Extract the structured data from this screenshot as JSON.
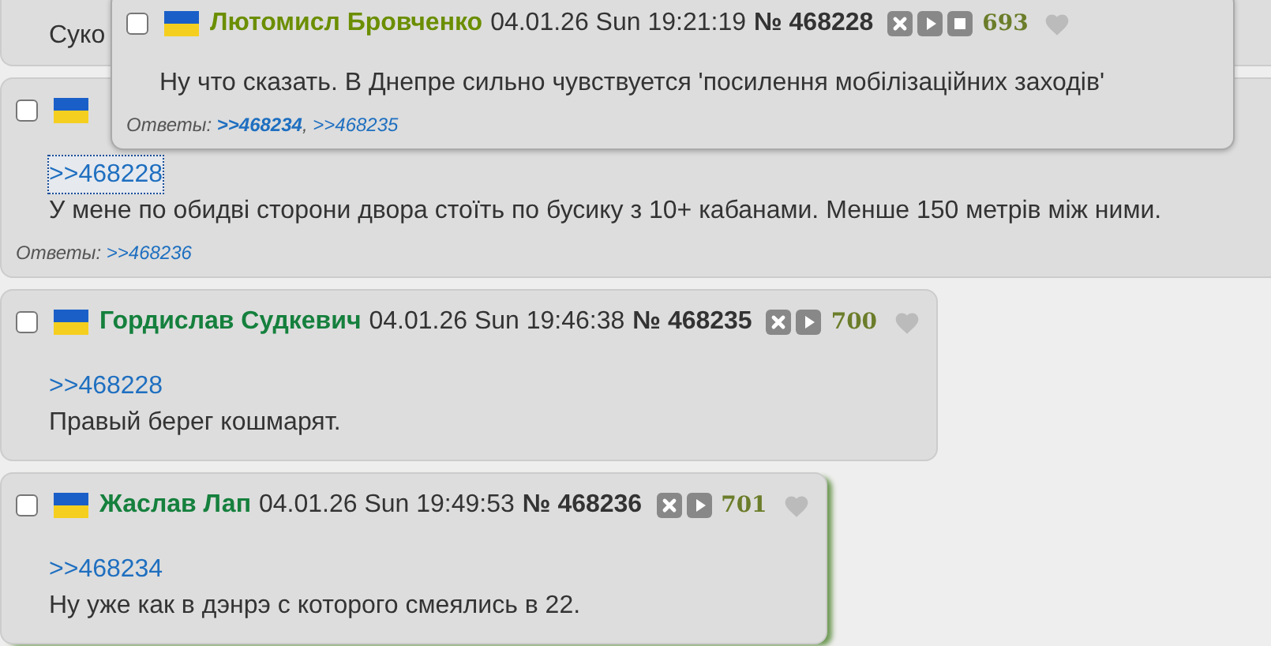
{
  "posts": [
    {
      "kind": "partial",
      "message": "Суко"
    },
    {
      "kind": "covered",
      "checked": false,
      "highlighted": false,
      "quote": {
        "text": ">>468228",
        "focused": true
      },
      "message": "У мене по обидві сторони двора стоїть по бусику з 10+ кабанами. Менше 150 метрів між ними.",
      "replies_label": "Ответы:",
      "replies": [
        {
          "text": ">>468236",
          "bold": false
        }
      ]
    },
    {
      "kind": "full",
      "checked": false,
      "highlighted": false,
      "author": "Гордислав Судкевич",
      "color": "#15803d",
      "date": "04.01.26 Sun 19:46:38",
      "number": "№ 468235",
      "buttons": [
        {
          "kind": "hide"
        },
        {
          "kind": "play"
        }
      ],
      "score": "700",
      "liked": false,
      "quote": {
        "text": ">>468228",
        "focused": false
      },
      "message": "Правый берег кошмарят."
    },
    {
      "kind": "full",
      "checked": false,
      "highlighted": true,
      "author": "Жаслав Лап",
      "color": "#15803d",
      "date": "04.01.26 Sun 19:49:53",
      "number": "№ 468236",
      "buttons": [
        {
          "kind": "hide"
        },
        {
          "kind": "play"
        }
      ],
      "score": "701",
      "liked": false,
      "quote": {
        "text": ">>468234",
        "focused": false
      },
      "message": "Ну уже как в дэнрэ с которого смеялись в 22."
    }
  ],
  "popup": {
    "kind": "full",
    "checked": false,
    "highlighted": false,
    "author": "Лютомисл Бровченко",
    "color": "#6b8e00",
    "date": "04.01.26 Sun 19:21:19",
    "number": "№ 468228",
    "buttons": [
      {
        "kind": "hide"
      },
      {
        "kind": "play"
      },
      {
        "kind": "stop"
      }
    ],
    "score": "693",
    "liked": false,
    "message": "Ну что сказать. В Днепре сильно чувствуется 'посилення мобілізаційних заходів'",
    "replies_label": "Ответы:",
    "separator": ",",
    "replies": [
      {
        "text": ">>468234",
        "bold": true
      },
      {
        "text": ">>468235",
        "bold": false
      }
    ]
  }
}
